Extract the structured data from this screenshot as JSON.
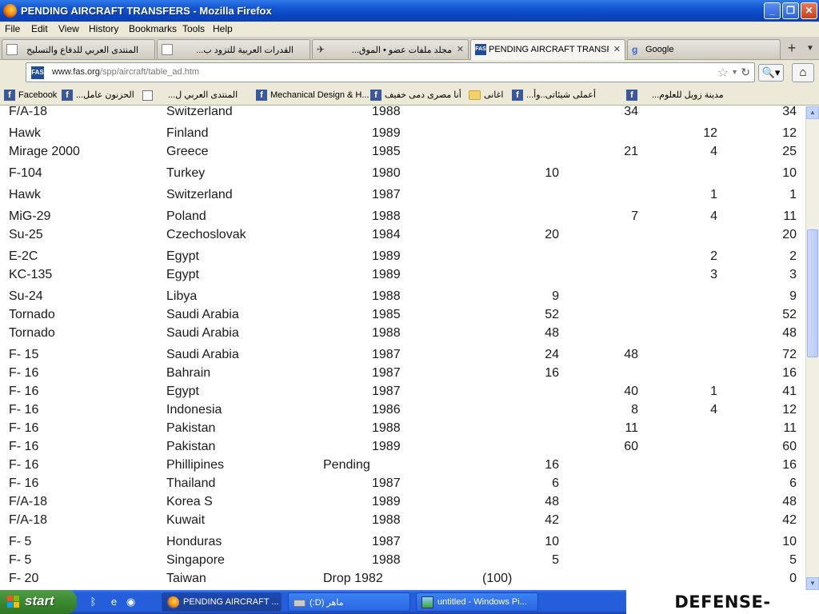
{
  "window": {
    "title": "PENDING AIRCRAFT TRANSFERS - Mozilla Firefox"
  },
  "menu": [
    "File",
    "Edit",
    "View",
    "History",
    "Bookmarks",
    "Tools",
    "Help"
  ],
  "tabs": [
    {
      "label": "المنتدى العربي للدفاع والتسليح",
      "icon": "blank-page-icon"
    },
    {
      "label": "القدرات العربية للتزود ب...",
      "icon": "blank-page-icon"
    },
    {
      "label": "مجلد ملفات عضو • الموق...",
      "icon": "jet-icon"
    },
    {
      "label": "PENDING AIRCRAFT TRANSF...",
      "icon": "fas-logo-icon"
    },
    {
      "label": "Google",
      "icon": "google-icon"
    }
  ],
  "nav": {
    "url_domain": "www.fas.org",
    "url_path": "/spp/aircraft/table_ad.htm",
    "site_badge": "FAS"
  },
  "bookmarks": [
    {
      "label": "Facebook",
      "icon": "facebook-icon"
    },
    {
      "label": "الحزنون عامل...",
      "icon": "facebook-icon"
    },
    {
      "label": "المنتدى العربي ل...",
      "icon": "blank-page-icon"
    },
    {
      "label": "Mechanical Design & H...",
      "icon": "facebook-icon"
    },
    {
      "label": "أنا مصرى دمى خفيف",
      "icon": "facebook-icon"
    },
    {
      "label": "اغانى",
      "icon": "folder-icon"
    },
    {
      "label": "أعملى شيئاتى..وأ...",
      "icon": "facebook-icon"
    },
    {
      "label": "مدينة زويل للعلوم...",
      "icon": "facebook-icon"
    }
  ],
  "table_rows": [
    {
      "aircraft": "F/A-18",
      "country": "Switzerland",
      "year": "1988",
      "v1": "",
      "v2": "34",
      "v3": "",
      "total": "34"
    },
    {
      "aircraft": "Hawk",
      "country": "Finland",
      "year": "1989",
      "v1": "",
      "v2": "",
      "v3": "12",
      "total": "12"
    },
    {
      "aircraft": "Mirage 2000",
      "country": "Greece",
      "year": "1985",
      "v1": "",
      "v2": "21",
      "v3": "4",
      "total": "25"
    },
    {
      "aircraft": "F-104",
      "country": "Turkey",
      "year": "1980",
      "v1": "10",
      "v2": "",
      "v3": "",
      "total": "10"
    },
    {
      "aircraft": "Hawk",
      "country": "Switzerland",
      "year": "1987",
      "v1": "",
      "v2": "",
      "v3": "1",
      "total": "1"
    },
    {
      "aircraft": "MiG-29",
      "country": "Poland",
      "year": "1988",
      "v1": "",
      "v2": "7",
      "v3": "4",
      "total": "11"
    },
    {
      "aircraft": "Su-25",
      "country": "Czechoslovak",
      "year": "1984",
      "v1": "20",
      "v2": "",
      "v3": "",
      "total": "20"
    },
    {
      "aircraft": "E-2C",
      "country": "Egypt",
      "year": "1989",
      "v1": "",
      "v2": "",
      "v3": "2",
      "total": "2"
    },
    {
      "aircraft": "KC-135",
      "country": "Egypt",
      "year": "1989",
      "v1": "",
      "v2": "",
      "v3": "3",
      "total": "3"
    },
    {
      "aircraft": "Su-24",
      "country": "Libya",
      "year": "1988",
      "v1": "9",
      "v2": "",
      "v3": "",
      "total": "9"
    },
    {
      "aircraft": "Tornado",
      "country": "Saudi Arabia",
      "year": "1985",
      "v1": "52",
      "v2": "",
      "v3": "",
      "total": "52"
    },
    {
      "aircraft": "Tornado",
      "country": "Saudi Arabia",
      "year": "1988",
      "v1": "48",
      "v2": "",
      "v3": "",
      "total": "48"
    },
    {
      "aircraft": "F- 15",
      "country": "Saudi Arabia",
      "year": "1987",
      "v1": "24",
      "v2": "48",
      "v3": "",
      "total": "72"
    },
    {
      "aircraft": "F- 16",
      "country": "Bahrain",
      "year": "1987",
      "v1": "16",
      "v2": "",
      "v3": "",
      "total": "16"
    },
    {
      "aircraft": "F- 16",
      "country": "Egypt",
      "year": "1987",
      "v1": "",
      "v2": "40",
      "v3": "1",
      "total": "41"
    },
    {
      "aircraft": "F- 16",
      "country": "Indonesia",
      "year": "1986",
      "v1": "",
      "v2": "8",
      "v3": "4",
      "total": "12"
    },
    {
      "aircraft": "F- 16",
      "country": "Pakistan",
      "year": "1988",
      "v1": "",
      "v2": "11",
      "v3": "",
      "total": "11"
    },
    {
      "aircraft": "F- 16",
      "country": "Pakistan",
      "year": "1989",
      "v1": "",
      "v2": "60",
      "v3": "",
      "total": "60"
    },
    {
      "aircraft": "F- 16",
      "country": "Phillipines",
      "pending": "Pending",
      "v1": "16",
      "v2": "",
      "v3": "",
      "total": "16"
    },
    {
      "aircraft": "F- 16",
      "country": "Thailand",
      "year": "1987",
      "v1": "6",
      "v2": "",
      "v3": "",
      "total": "6"
    },
    {
      "aircraft": "F/A-18",
      "country": "Korea S",
      "year": "1989",
      "v1": "48",
      "v2": "",
      "v3": "",
      "total": "48"
    },
    {
      "aircraft": "F/A-18",
      "country": "Kuwait",
      "year": "1988",
      "v1": "42",
      "v2": "",
      "v3": "",
      "total": "42"
    },
    {
      "aircraft": "F- 5",
      "country": "Honduras",
      "year": "1987",
      "v1": "10",
      "v2": "",
      "v3": "",
      "total": "10"
    },
    {
      "aircraft": "F- 5",
      "country": "Singapore",
      "year": "1988",
      "v1": "5",
      "v2": "",
      "v3": "",
      "total": "5"
    },
    {
      "aircraft": "F- 20",
      "country": "Taiwan",
      "pending": "Drop 1982",
      "paren": "(100)",
      "v1": "",
      "v2": "",
      "v3": "",
      "total": "0"
    }
  ],
  "taskbar": {
    "start_label": "start",
    "tasks": [
      {
        "label": "PENDING AIRCRAFT ...",
        "icon": "firefox-icon",
        "active": true
      },
      {
        "label": "ماهر (D:)",
        "icon": "drive-icon",
        "active": false
      },
      {
        "label": "untitled - Windows Pi...",
        "icon": "paint-icon",
        "active": false
      }
    ]
  },
  "watermark": "DEFENSE-ARAB.COM"
}
